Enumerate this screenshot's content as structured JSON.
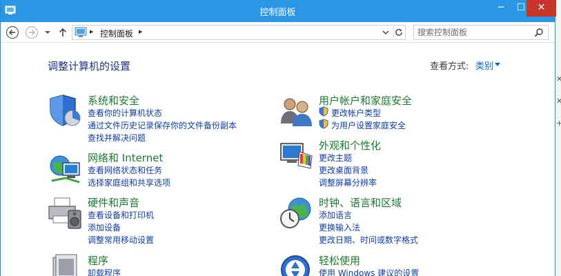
{
  "window": {
    "title": "控制面板"
  },
  "titlebar": {
    "minimize": "─",
    "maximize": "☐",
    "close": "✕"
  },
  "address": {
    "path_root": "控制面板",
    "separator": "▸"
  },
  "search": {
    "placeholder": "搜索控制面板"
  },
  "heading": "调整计算机的设置",
  "view": {
    "label": "查看方式:",
    "value": "类别"
  },
  "categories": [
    {
      "title": "系统和安全",
      "icon": "shield-pie-icon",
      "links": [
        "查看你的计算机状态",
        "通过文件历史记录保存你的文件备份副本",
        "查找并解决问题"
      ]
    },
    {
      "title": "网络和 Internet",
      "icon": "network-globe-icon",
      "links": [
        "查看网络状态和任务",
        "选择家庭组和共享选项"
      ]
    },
    {
      "title": "硬件和声音",
      "icon": "printer-speaker-icon",
      "links": [
        "查看设备和打印机",
        "添加设备",
        "调整常用移动设置"
      ]
    },
    {
      "title": "程序",
      "icon": "programs-icon",
      "links": [
        "卸载程序"
      ]
    },
    {
      "title": "用户帐户和家庭安全",
      "icon": "users-icon",
      "links": [
        "更改帐户类型",
        "为用户设置家庭安全"
      ]
    },
    {
      "title": "外观和个性化",
      "icon": "monitor-palette-icon",
      "links": [
        "更改主题",
        "更改桌面背景",
        "调整屏幕分辨率"
      ]
    },
    {
      "title": "时钟、语言和区域",
      "icon": "globe-clock-icon",
      "links": [
        "添加语言",
        "更换输入法",
        "更改日期、时间或数字格式"
      ]
    },
    {
      "title": "轻松使用",
      "icon": "ease-of-access-icon",
      "links": [
        "使用 Windows 建议的设置"
      ]
    }
  ],
  "colors": {
    "titlebar": "#2a96e4",
    "close": "#c6362b",
    "heading": "#1e3287",
    "category": "#1a7a2e",
    "link": "#0f3dab"
  },
  "edge_marks": [
    "✕",
    "✕",
    "+"
  ]
}
